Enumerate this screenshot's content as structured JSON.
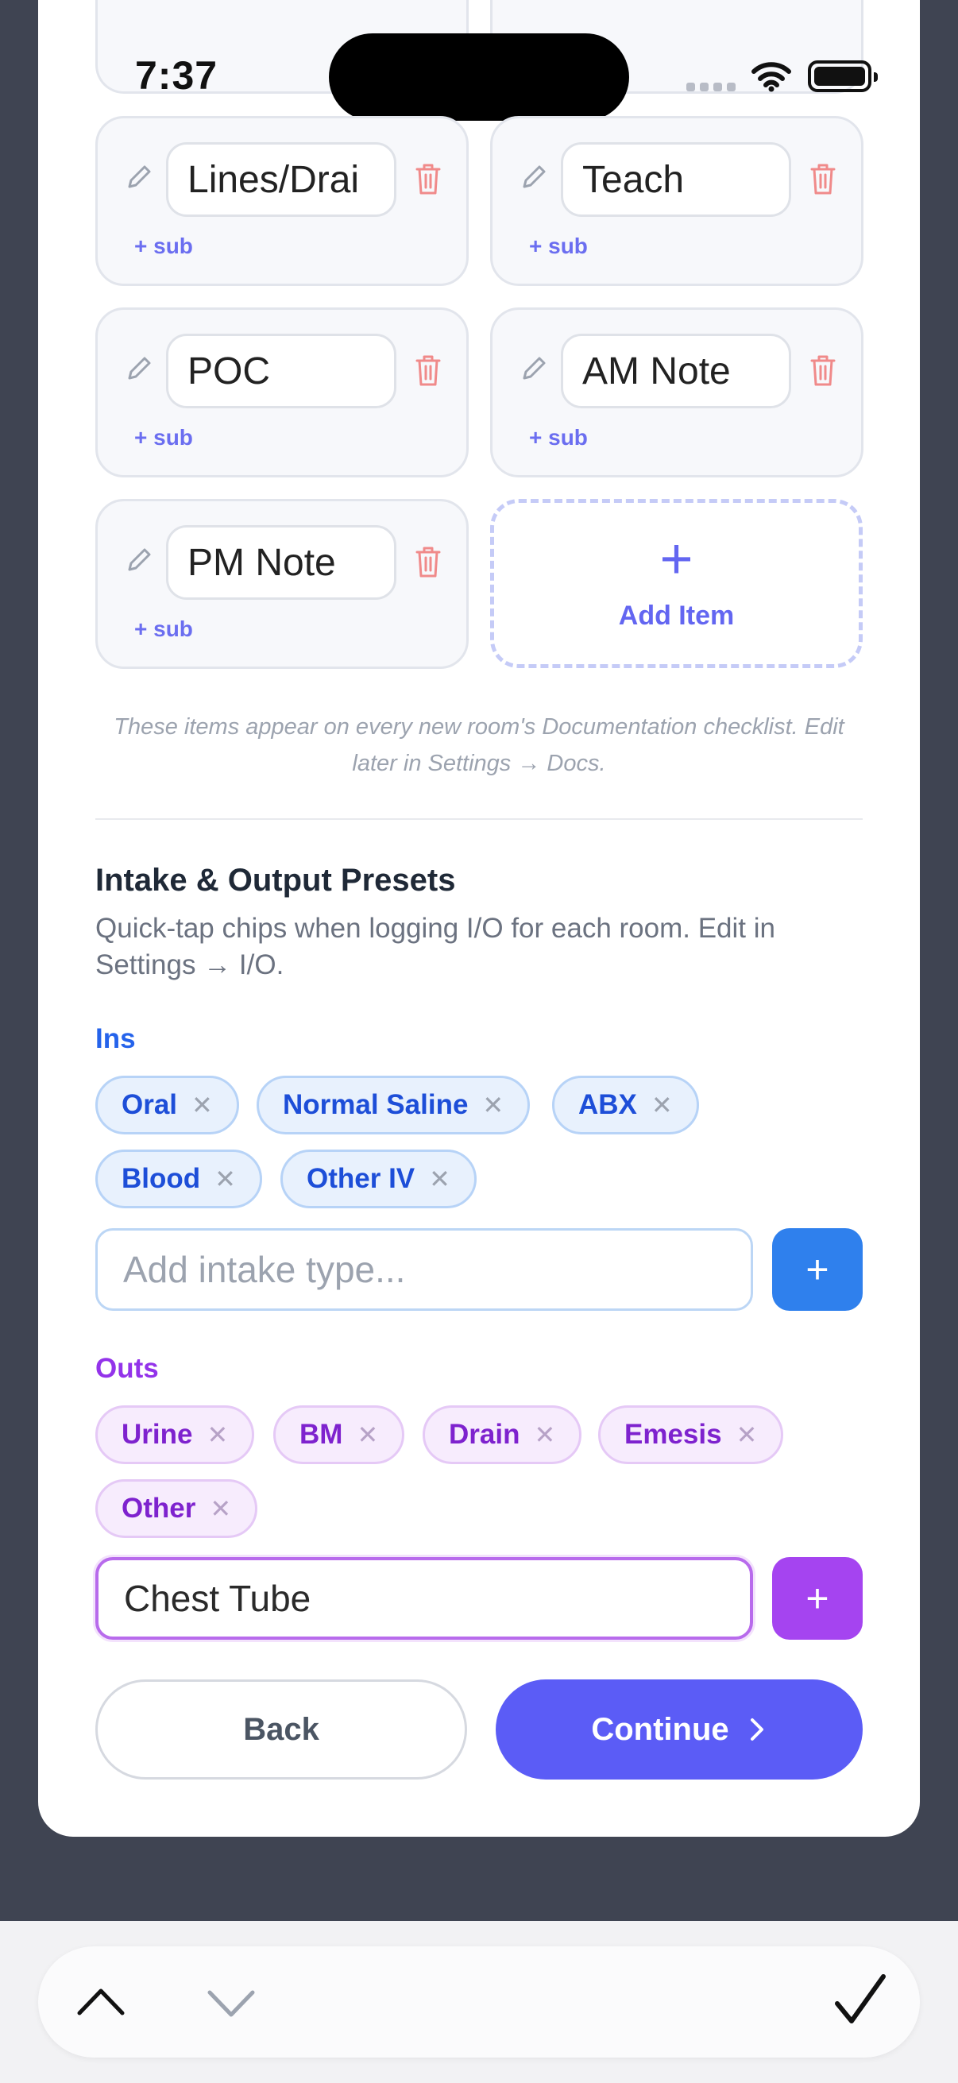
{
  "status": {
    "time": "7:37"
  },
  "doc_items": [
    {
      "label": "Lines/Drai",
      "sub": "+ sub"
    },
    {
      "label": "Teach",
      "sub": "+ sub"
    },
    {
      "label": "POC",
      "sub": "+ sub"
    },
    {
      "label": "AM Note",
      "sub": "+ sub"
    },
    {
      "label": "PM Note",
      "sub": "+ sub"
    }
  ],
  "add_item_label": "Add Item",
  "doc_note": "These items appear on every new room's Documentation checklist. Edit later in Settings → Docs.",
  "io": {
    "title": "Intake & Output Presets",
    "description": "Quick-tap chips when logging I/O for each room. Edit in Settings → I/O.",
    "ins_label": "Ins",
    "ins_chips": [
      "Oral",
      "Normal Saline",
      "ABX",
      "Blood",
      "Other IV"
    ],
    "intake_placeholder": "Add intake type...",
    "outs_label": "Outs",
    "outs_chips": [
      "Urine",
      "BM",
      "Drain",
      "Emesis",
      "Other"
    ],
    "output_value": "Chest Tube",
    "add_glyph": "+"
  },
  "buttons": {
    "back": "Back",
    "continue": "Continue"
  },
  "colors": {
    "primary": "#5b5cf6",
    "ins": "#2f80ed",
    "outs": "#a544f0"
  },
  "icons": [
    "pencil-icon",
    "trash-icon",
    "plus-icon",
    "chevron-right-icon",
    "chevron-up-icon",
    "chevron-down-icon",
    "checkmark-icon"
  ]
}
